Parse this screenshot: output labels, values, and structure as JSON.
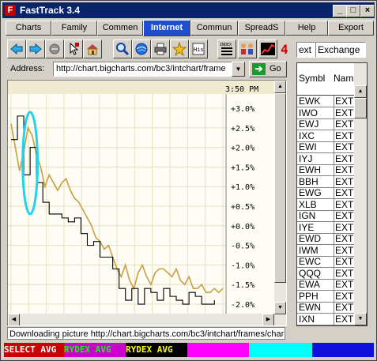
{
  "window": {
    "title": "FastTrack 3.4",
    "app_icon_glyph": "F"
  },
  "tabs": [
    {
      "label": "Charts",
      "active": false
    },
    {
      "label": "Family",
      "active": false
    },
    {
      "label": "Commen",
      "active": false
    },
    {
      "label": "Internet",
      "active": true
    },
    {
      "label": "Commun",
      "active": false
    },
    {
      "label": "SpreadS",
      "active": false
    },
    {
      "label": "Help",
      "active": false
    },
    {
      "label": "Export",
      "active": false
    }
  ],
  "toolbar": {
    "icons": [
      "arrow-left-icon",
      "arrow-right-icon",
      "stop-icon",
      "cursor-icon",
      "home-icon",
      "search-icon",
      "globe-icon",
      "printer-icon",
      "star-icon",
      "history-icon",
      "index-icon",
      "people-icon",
      "chart-icon",
      "red-four-icon"
    ],
    "index_text": "INDEX",
    "history_text": "His"
  },
  "address": {
    "label": "Address:",
    "url": "http://chart.bigcharts.com/bc3/intchart/frame",
    "go_label": "Go"
  },
  "chart_data": {
    "type": "line",
    "time_label": "3:50 PM",
    "ylim": [
      -2.1,
      3.1
    ],
    "y_ticks": [
      "+3.0%",
      "+2.5%",
      "+2.0%",
      "+1.5%",
      "+1.0%",
      "+0.5%",
      "+0.0%",
      "-0.5%",
      "-1.0%",
      "-1.5%",
      "-2.0%"
    ],
    "y_tick_values": [
      3.0,
      2.5,
      2.0,
      1.5,
      1.0,
      0.5,
      0.0,
      -0.5,
      -1.0,
      -1.5,
      -2.0
    ],
    "x_range": [
      0,
      100
    ],
    "series": [
      {
        "color": "#c8a040",
        "x": [
          0,
          2,
          4,
          6,
          8,
          10,
          12,
          14,
          16,
          18,
          20,
          22,
          24,
          26,
          28,
          30,
          32,
          34,
          36,
          38,
          40,
          42,
          44,
          46,
          48,
          50,
          52,
          54,
          56,
          58,
          60,
          62,
          64,
          66,
          68,
          70,
          72,
          74,
          76,
          78,
          80,
          82,
          84,
          86,
          88,
          90,
          92,
          94,
          96,
          98,
          100
        ],
        "values": [
          2.6,
          2.0,
          1.4,
          1.9,
          2.5,
          2.3,
          1.8,
          1.5,
          1.0,
          1.3,
          1.1,
          0.9,
          1.1,
          1.2,
          0.9,
          0.7,
          0.6,
          0.4,
          0.2,
          0.0,
          -0.3,
          -0.4,
          -0.6,
          -0.5,
          -0.8,
          -1.1,
          -1.3,
          -1.0,
          -1.4,
          -1.6,
          -1.2,
          -1.0,
          -1.3,
          -1.5,
          -1.2,
          -1.1,
          -1.1,
          -1.2,
          -1.3,
          -1.1,
          -1.4,
          -1.5,
          -1.3,
          -1.6,
          -1.6,
          -1.5,
          -1.7,
          -1.7,
          -1.6,
          -1.7,
          -1.6
        ]
      },
      {
        "color": "#000000",
        "x": [
          0,
          3,
          6,
          9,
          12,
          15,
          18,
          21,
          24,
          27,
          30,
          33,
          36,
          39,
          42,
          45,
          48,
          51,
          54,
          57,
          60,
          63,
          66,
          69,
          72,
          75,
          78,
          81,
          84,
          87,
          90,
          93,
          96
        ],
        "values": [
          2.2,
          2.8,
          1.3,
          2.0,
          1.1,
          0.6,
          0.3,
          0.3,
          0.2,
          0.1,
          0.2,
          -0.2,
          -0.5,
          -0.4,
          -0.8,
          -0.8,
          -1.1,
          -1.6,
          -1.9,
          -1.6,
          -2.0,
          -1.6,
          -1.7,
          -1.9,
          -1.6,
          -1.8,
          -1.9,
          -2.0,
          -1.7,
          -1.8,
          -2.0,
          -2.0,
          -1.9
        ]
      }
    ],
    "highlight_ellipse": {
      "x_center": 9,
      "y_center": 1.6,
      "x_half": 3.5,
      "y_half": 1.3,
      "color": "#22d3ee"
    }
  },
  "status": {
    "text": "Downloading picture http://chart.bigcharts.com/bc3/intchart/frames/char"
  },
  "bottom_strip": [
    {
      "text": "SELECT AVG",
      "bg": "#cc0000",
      "fg": "#ffffff"
    },
    {
      "text": "RYDEX AVG",
      "bg": "#cc00cc",
      "fg": "#00ff00"
    },
    {
      "text": "RYDEX AVG",
      "bg": "#000000",
      "fg": "#ffff00"
    },
    {
      "text": "",
      "bg": "#ff00ff",
      "fg": "#000000"
    },
    {
      "text": "",
      "bg": "#00ffff",
      "fg": "#000000"
    },
    {
      "text": "",
      "bg": "#1010dd",
      "fg": "#000000"
    }
  ],
  "right_panel": {
    "ext_combo": "ext",
    "exchange_combo": "Exchange",
    "columns": [
      "Symbl",
      "Nam"
    ],
    "rows": [
      [
        "EWK",
        "EXT"
      ],
      [
        "IWO",
        "EXT"
      ],
      [
        "EWJ",
        "EXT"
      ],
      [
        "IXC",
        "EXT"
      ],
      [
        "EWI",
        "EXT"
      ],
      [
        "IYJ",
        "EXT"
      ],
      [
        "EWH",
        "EXT"
      ],
      [
        "BBH",
        "EXT"
      ],
      [
        "EWG",
        "EXT"
      ],
      [
        "XLB",
        "EXT"
      ],
      [
        "IGN",
        "EXT"
      ],
      [
        "IYE",
        "EXT"
      ],
      [
        "EWD",
        "EXT"
      ],
      [
        "IWM",
        "EXT"
      ],
      [
        "EWC",
        "EXT"
      ],
      [
        "QQQ",
        "EXT"
      ],
      [
        "EWA",
        "EXT"
      ],
      [
        "PPH",
        "EXT"
      ],
      [
        "EWN",
        "EXT"
      ],
      [
        "IXN",
        "EXT"
      ]
    ]
  },
  "colors": {
    "title_bar": "#0a246a",
    "active_tab": "#1f4fd0",
    "chart_bg": "#fdfcf5",
    "grid": "#e6dfc0"
  }
}
